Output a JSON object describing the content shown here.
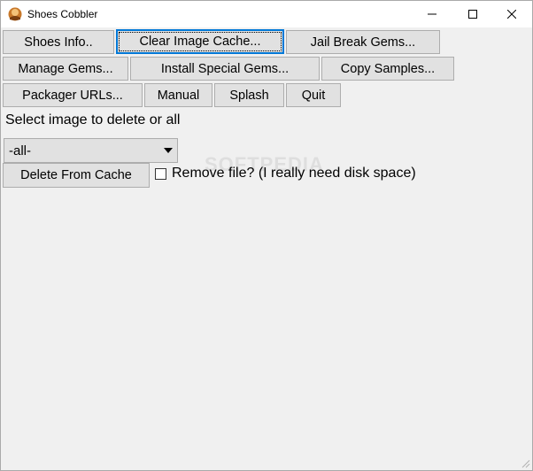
{
  "window": {
    "title": "Shoes Cobbler"
  },
  "toolbar": {
    "row1": [
      "Shoes Info..",
      "Clear Image Cache...",
      "Jail Break Gems..."
    ],
    "row2": [
      "Manage Gems...",
      "Install Special Gems...",
      "Copy Samples..."
    ],
    "row3": [
      "Packager URLs...",
      "Manual",
      "Splash",
      "Quit"
    ]
  },
  "main": {
    "prompt": "Select image to delete or all",
    "select_value": "-all-",
    "delete_button": "Delete From Cache",
    "checkbox_label": "Remove file? (I really need disk space)",
    "checkbox_checked": false
  },
  "watermark": "SOFTPEDIA",
  "colors": {
    "focus_border": "#0078d7",
    "button_bg": "#e1e1e1",
    "window_bg": "#f0f0f0"
  }
}
